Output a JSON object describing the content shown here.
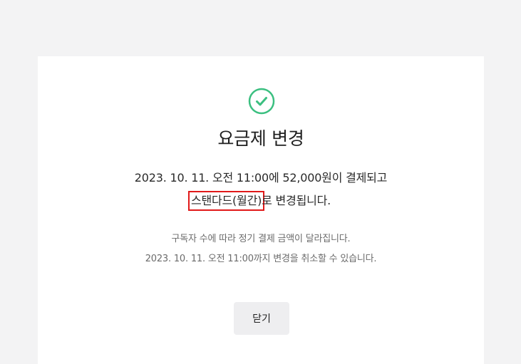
{
  "dialog": {
    "title": "요금제 변경",
    "message_line1": "2023. 10. 11. 오전 11:00에 52,000원이 결제되고",
    "plan_name": "스탠다드(월간)",
    "message_line2_suffix": "로 변경됩니다.",
    "note_line1": "구독자 수에 따라 정기 결제 금액이 달라집니다.",
    "note_line2": "2023. 10. 11. 오전 11:00까지 변경을 취소할 수 있습니다.",
    "close_label": "닫기"
  },
  "colors": {
    "success_green": "#3bbf80",
    "highlight_red": "#e11919",
    "background": "#f3f3f4",
    "button_bg": "#eeeef0"
  },
  "icons": {
    "status": "check-circle-icon"
  }
}
